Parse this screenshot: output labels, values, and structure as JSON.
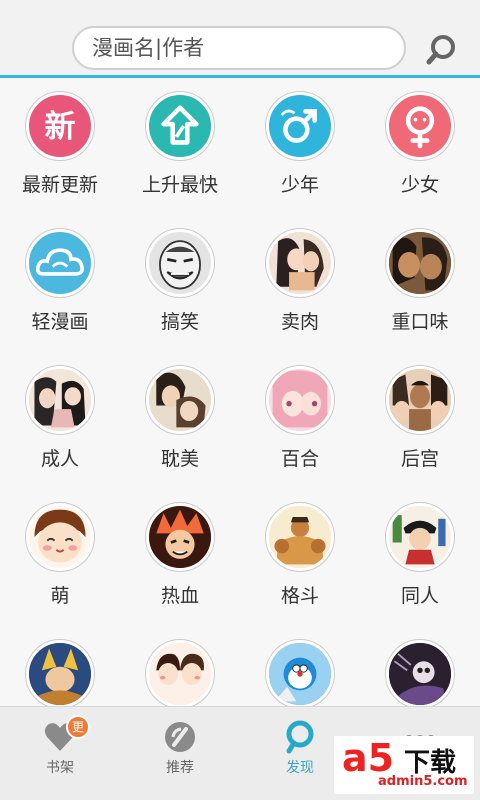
{
  "search": {
    "placeholder": "漫画名|作者"
  },
  "categories": [
    {
      "label": "最新更新",
      "icon": "new-badge-icon",
      "color": "#e8577a",
      "glyph": "新"
    },
    {
      "label": "上升最快",
      "icon": "rising-arrow-icon",
      "color": "#2bb8b0",
      "glyph": "⇧"
    },
    {
      "label": "少年",
      "icon": "male-symbol-icon",
      "color": "#2fb4dc",
      "glyph": "♂"
    },
    {
      "label": "少女",
      "icon": "female-symbol-icon",
      "color": "#ef6a76",
      "glyph": "♀"
    },
    {
      "label": "轻漫画",
      "icon": "cloud-icon",
      "color": "#4cb8e0",
      "glyph": "☁"
    },
    {
      "label": "搞笑",
      "icon": "meme-face-thumbnail",
      "color": "#d9d9d9"
    },
    {
      "label": "卖肉",
      "icon": "anime-girls-thumbnail",
      "color": "#e8d8c8"
    },
    {
      "label": "重口味",
      "icon": "dark-kiss-thumbnail",
      "color": "#5a3a28"
    },
    {
      "label": "成人",
      "icon": "adult-manga-thumbnail",
      "color": "#e6c6b8"
    },
    {
      "label": "耽美",
      "icon": "boys-love-thumbnail",
      "color": "#c8b090"
    },
    {
      "label": "百合",
      "icon": "girls-love-thumbnail",
      "color": "#f2b8c0"
    },
    {
      "label": "后宫",
      "icon": "harem-thumbnail",
      "color": "#c89a78"
    },
    {
      "label": "萌",
      "icon": "cute-face-thumbnail",
      "color": "#f6e0c8"
    },
    {
      "label": "热血",
      "icon": "action-hero-thumbnail",
      "color": "#d85a30"
    },
    {
      "label": "格斗",
      "icon": "fighter-thumbnail",
      "color": "#d8a050"
    },
    {
      "label": "同人",
      "icon": "fan-work-thumbnail",
      "color": "#e8e0d0"
    },
    {
      "label": "",
      "icon": "fantasy-character-thumbnail",
      "color": "#3a5a8a"
    },
    {
      "label": "",
      "icon": "couple-cartoon-thumbnail",
      "color": "#f4d8c8"
    },
    {
      "label": "",
      "icon": "robot-cat-thumbnail",
      "color": "#4aa8e0"
    },
    {
      "label": "",
      "icon": "dark-skull-thumbnail",
      "color": "#3a3040"
    }
  ],
  "nav": [
    {
      "label": "书架",
      "icon": "heart-icon",
      "badge": "更"
    },
    {
      "label": "推荐",
      "icon": "recommend-icon"
    },
    {
      "label": "发现",
      "icon": "discover-search-icon",
      "active": true
    },
    {
      "label": "",
      "icon": "more-icon"
    }
  ],
  "watermark": {
    "big": "a5",
    "text": "下载",
    "sub": "admin5.com"
  },
  "colors": {
    "accent": "#35b6d6",
    "badge": "#f07a35"
  }
}
